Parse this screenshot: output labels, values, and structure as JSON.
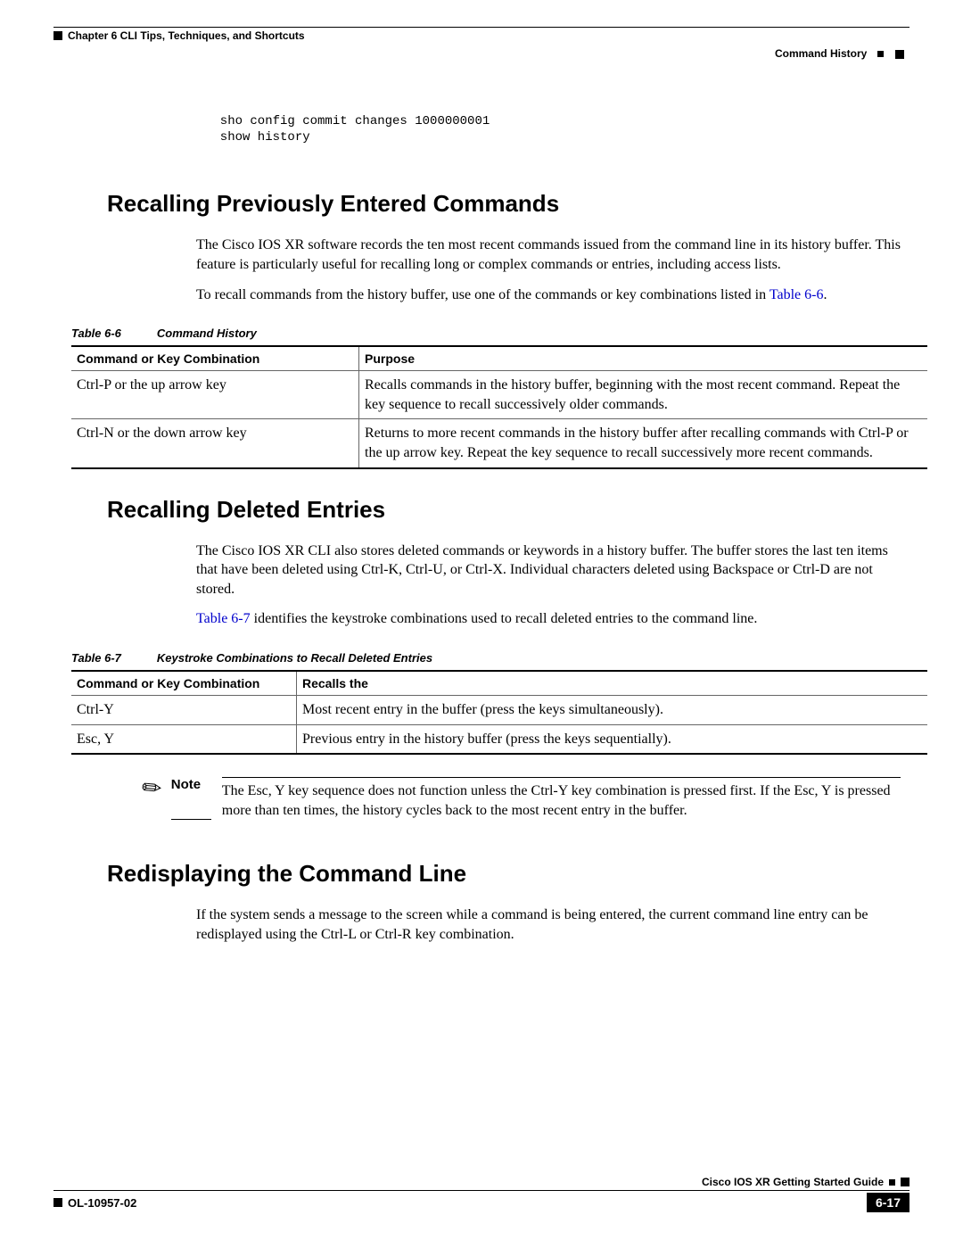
{
  "header": {
    "chapter": "Chapter 6      CLI Tips, Techniques, and Shortcuts",
    "section": "Command History"
  },
  "code": "  sho config commit changes 1000000001\n  show history",
  "s1": {
    "title": "Recalling Previously Entered Commands",
    "p1": "The Cisco IOS XR software records the ten most recent commands issued from the command line in its history buffer. This feature is particularly useful for recalling long or complex commands or entries, including access lists.",
    "p2a": "To recall commands from the history buffer, use one of the commands or key combinations listed in ",
    "p2link": "Table 6-6",
    "p2b": "."
  },
  "t66": {
    "num": "Table 6-6",
    "title": "Command History",
    "h1": "Command or Key Combination",
    "h2": "Purpose",
    "r1c1": "Ctrl-P or the up arrow key",
    "r1c2": "Recalls commands in the history buffer, beginning with the most recent command. Repeat the key sequence to recall successively older commands.",
    "r2c1": "Ctrl-N or the down arrow key",
    "r2c2": "Returns to more recent commands in the history buffer after recalling commands with Ctrl-P or the up arrow key. Repeat the key sequence to recall successively more recent commands."
  },
  "s2": {
    "title": "Recalling Deleted Entries",
    "p1": "The Cisco IOS XR CLI also stores deleted commands or keywords in a history buffer. The buffer stores the last ten items that have been deleted using Ctrl-K, Ctrl-U, or Ctrl-X. Individual characters deleted using Backspace or Ctrl-D are not stored.",
    "p2link": "Table 6-7",
    "p2b": " identifies the keystroke combinations used to recall deleted entries to the command line."
  },
  "t67": {
    "num": "Table 6-7",
    "title": "Keystroke Combinations to Recall Deleted Entries",
    "h1": "Command or Key Combination",
    "h2": "Recalls the",
    "r1c1": "Ctrl-Y",
    "r1c2": "Most recent entry in the buffer (press the keys simultaneously).",
    "r2c1": "Esc, Y",
    "r2c2": "Previous entry in the history buffer (press the keys sequentially)."
  },
  "note": {
    "label": "Note",
    "text": "The Esc, Y key sequence does not function unless the Ctrl-Y key combination is pressed first. If the Esc, Y is pressed more than ten times, the history cycles back to the most recent entry in the buffer."
  },
  "s3": {
    "title": "Redisplaying the Command Line",
    "p1": "If the system sends a message to the screen while a command is being entered, the current command line entry can be redisplayed using the Ctrl-L or Ctrl-R key combination."
  },
  "footer": {
    "guide": "Cisco IOS XR Getting Started Guide",
    "docid": "OL-10957-02",
    "page": "6-17"
  }
}
